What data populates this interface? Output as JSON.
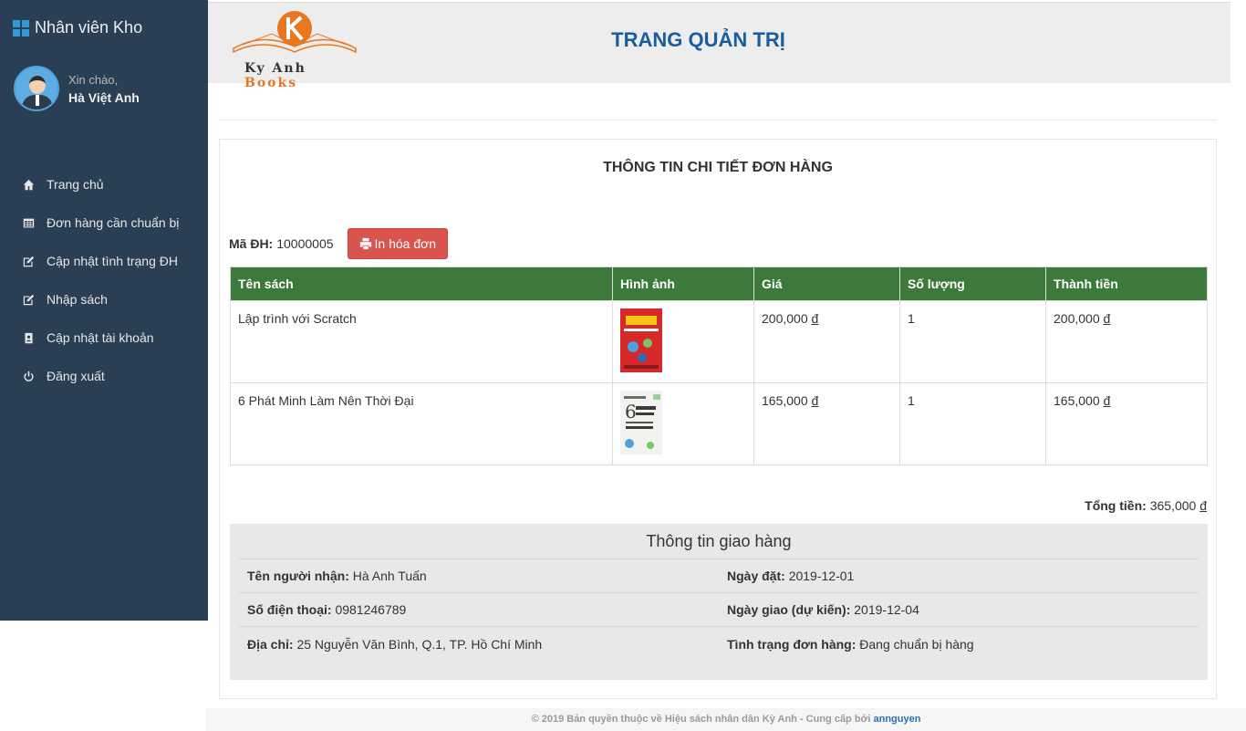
{
  "sidebar": {
    "brand": "Nhân viên Kho",
    "greeting": "Xin chào,",
    "username": "Hà Việt Anh",
    "menu": [
      {
        "label": "Trang chủ",
        "icon": "home-icon"
      },
      {
        "label": "Đơn hàng cần chuẩn bị",
        "icon": "table-icon"
      },
      {
        "label": "Cập nhật tình trạng ĐH",
        "icon": "edit-icon"
      },
      {
        "label": "Nhập sách",
        "icon": "edit-icon"
      },
      {
        "label": "Cập nhật tài khoản",
        "icon": "address-book-icon"
      },
      {
        "label": "Đăng xuất",
        "icon": "power-icon"
      }
    ]
  },
  "header": {
    "logo_text_1": "Ky Anh",
    "logo_text_2": "Books",
    "title": "TRANG QUẢN TRỊ"
  },
  "order": {
    "panel_title": "THÔNG TIN CHI TIẾT ĐƠN HÀNG",
    "code_label": "Mã ĐH:",
    "code_value": "10000005",
    "print_label": "In hóa đơn",
    "columns": [
      "Tên sách",
      "Hình ảnh",
      "Giá",
      "Số lượng",
      "Thành tiền"
    ],
    "items": [
      {
        "name": "Lập trình với Scratch",
        "price": "200,000",
        "qty": "1",
        "subtotal": "200,000",
        "currency": "đ",
        "cover_color": "#d62a2a"
      },
      {
        "name": "6 Phát Minh Làm Nên Thời Đại",
        "price": "165,000",
        "qty": "1",
        "subtotal": "165,000",
        "currency": "đ",
        "cover_color": "#f2f2ee"
      }
    ],
    "total_label": "Tổng tiền:",
    "total_value": "365,000",
    "currency": "đ"
  },
  "shipping": {
    "title": "Thông tin giao hàng",
    "receiver_label": "Tên người nhận:",
    "receiver_value": "Hà Anh Tuấn",
    "order_date_label": "Ngày đặt:",
    "order_date_value": "2019-12-01",
    "phone_label": "Số điện thoại:",
    "phone_value": "0981246789",
    "delivery_date_label": "Ngày giao (dự kiến):",
    "delivery_date_value": "2019-12-04",
    "address_label": "Địa chỉ:",
    "address_value": "25 Nguyễn Văn Bình, Q.1, TP. Hồ Chí Minh",
    "status_label": "Tình trạng đơn hàng:",
    "status_value": "Đang chuẩn bị hàng"
  },
  "footer": {
    "text": "© 2019 Bản quyền thuộc về Hiệu sách nhân dân Kỳ Anh - Cung cấp bởi",
    "link": "annguyen"
  },
  "colors": {
    "sidebar_bg": "#2a3f54",
    "table_header": "#3b7a3b",
    "print_button": "#d9534f",
    "heading_blue": "#1a5c9e"
  }
}
